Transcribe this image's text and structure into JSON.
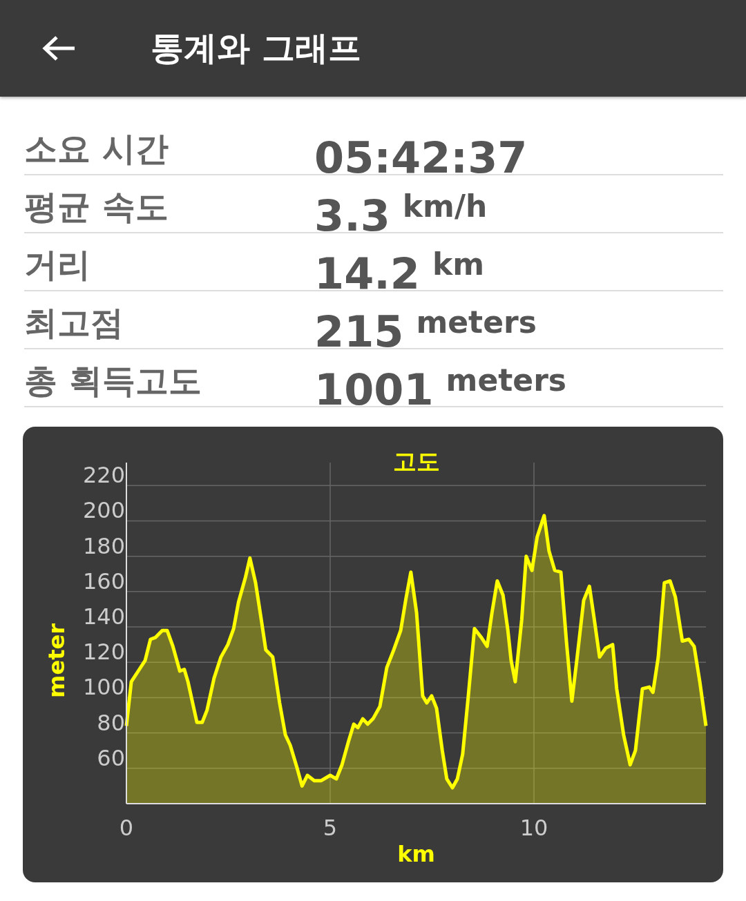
{
  "app_bar": {
    "title": "통계와 그래프"
  },
  "stats": [
    {
      "label": "소요 시간",
      "value": "05:42:37"
    },
    {
      "label": "평균 속도",
      "value": "3.3",
      "unit": "km/h"
    },
    {
      "label": "거리",
      "value": "14.2",
      "unit": "km"
    },
    {
      "label": "최고점",
      "value": "215",
      "unit": "meters"
    },
    {
      "label": "총 획득고도",
      "value": "1001",
      "unit": "meters"
    }
  ],
  "chart": {
    "chart_data": {
      "type": "area",
      "grid": true,
      "xlabel": "km",
      "ylabel": "meter",
      "xlim": [
        0,
        14.22
      ],
      "ylim": [
        40,
        233
      ],
      "xticks": [
        0,
        5,
        10
      ],
      "yticks": [
        60,
        80,
        100,
        120,
        140,
        160,
        180,
        200,
        220
      ],
      "x": [
        0,
        0.12,
        0.29,
        0.46,
        0.59,
        0.71,
        0.88,
        1.0,
        1.14,
        1.31,
        1.42,
        1.51,
        1.73,
        1.86,
        1.98,
        2.15,
        2.32,
        2.49,
        2.63,
        2.75,
        2.92,
        3.03,
        3.17,
        3.31,
        3.42,
        3.59,
        3.76,
        3.9,
        4.02,
        4.19,
        4.31,
        4.44,
        4.61,
        4.78,
        5.0,
        5.15,
        5.29,
        5.46,
        5.58,
        5.68,
        5.8,
        5.92,
        6.05,
        6.22,
        6.39,
        6.56,
        6.73,
        6.86,
        6.98,
        7.12,
        7.27,
        7.37,
        7.49,
        7.61,
        7.75,
        7.86,
        8.0,
        8.12,
        8.25,
        8.39,
        8.54,
        8.71,
        8.85,
        8.97,
        9.1,
        9.24,
        9.36,
        9.44,
        9.54,
        9.7,
        9.81,
        9.95,
        10.08,
        10.25,
        10.37,
        10.51,
        10.66,
        10.8,
        10.93,
        11.05,
        11.22,
        11.36,
        11.47,
        11.61,
        11.76,
        11.93,
        12.03,
        12.2,
        12.36,
        12.49,
        12.66,
        12.83,
        12.92,
        13.05,
        13.2,
        13.34,
        13.47,
        13.64,
        13.8,
        13.93,
        14.07,
        14.22
      ],
      "series": [
        {
          "name": "고도",
          "color": "#ffff00",
          "values": [
            84,
            109,
            115,
            121,
            133,
            134,
            138,
            138,
            129,
            115,
            116,
            109,
            86,
            86,
            93,
            111,
            123,
            130,
            139,
            154,
            168,
            179,
            165,
            144,
            127,
            123,
            97,
            79,
            73,
            60,
            50,
            56,
            53,
            53,
            56,
            54,
            62,
            76,
            85,
            83,
            88,
            85,
            88,
            95,
            117,
            127,
            138,
            156,
            171,
            148,
            101,
            97,
            101,
            94,
            70,
            54,
            49,
            54,
            68,
            101,
            139,
            134,
            129,
            148,
            166,
            158,
            138,
            121,
            109,
            144,
            180,
            172,
            191,
            203,
            183,
            172,
            171,
            131,
            98,
            121,
            155,
            163,
            146,
            123,
            128,
            130,
            105,
            79,
            62,
            70,
            105,
            106,
            103,
            123,
            165,
            166,
            157,
            132,
            133,
            129,
            109,
            84
          ]
        }
      ]
    }
  }
}
